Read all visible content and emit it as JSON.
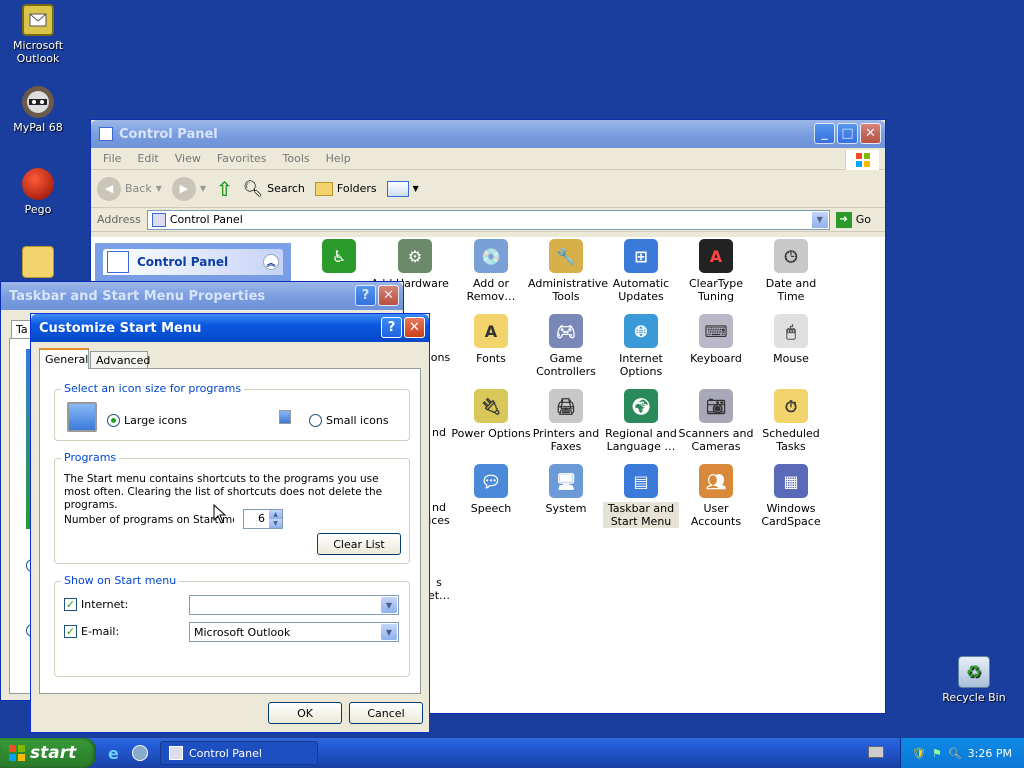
{
  "desktop": {
    "icons": [
      {
        "label": "Microsoft Outlook",
        "icon": "outlook-icon"
      },
      {
        "label": "MyPal 68",
        "icon": "raccoon-icon"
      },
      {
        "label": "Pego",
        "icon": "pego-icon"
      },
      {
        "label": "Recycle Bin",
        "icon": "recycle-bin-icon"
      }
    ]
  },
  "control_panel": {
    "title": "Control Panel",
    "menu": [
      "File",
      "Edit",
      "View",
      "Favorites",
      "Tools",
      "Help"
    ],
    "toolbar": {
      "back": "Back",
      "search": "Search",
      "folders": "Folders"
    },
    "address_label": "Address",
    "address_value": "Control Panel",
    "go_label": "Go",
    "sidebar_title": "Control Panel",
    "items": [
      "Add Hardware",
      "Add or Remov…",
      "Administrative Tools",
      "Automatic Updates",
      "ClearType Tuning",
      "Date and Time",
      "Fonts",
      "Game Controllers",
      "Internet Options",
      "Keyboard",
      "Mouse",
      "Power Options",
      "Printers and Faxes",
      "Regional and Language …",
      "Scanners and Cameras",
      "Scheduled Tasks",
      "Speech",
      "System",
      "Taskbar and Start Menu",
      "User Accounts",
      "Windows CardSpace"
    ],
    "partial_labels": {
      "row2": "ions",
      "row3a": "nd",
      "row4a": "nd",
      "row4b": "ices",
      "row5a": "s",
      "row5b": "et…"
    }
  },
  "taskbar_props": {
    "title": "Taskbar and Start Menu Properties",
    "tab_stub": "Ta"
  },
  "customize": {
    "title": "Customize Start Menu",
    "tabs": [
      "General",
      "Advanced"
    ],
    "icon_size_group": "Select an icon size for programs",
    "large_icons": "Large icons",
    "small_icons": "Small icons",
    "programs_group": "Programs",
    "programs_desc": "The Start menu contains shortcuts to the programs you use most often. Clearing the list of shortcuts does not delete the programs.",
    "num_programs_label": "Number of programs on Start menu:",
    "num_programs_value": "6",
    "clear_list": "Clear List",
    "show_group": "Show on Start menu",
    "internet_label": "Internet:",
    "internet_value": "",
    "email_label": "E-mail:",
    "email_value": "Microsoft Outlook",
    "ok": "OK",
    "cancel": "Cancel"
  },
  "taskbar": {
    "start_label": "start",
    "task_label": "Control Panel",
    "clock": "3:26 PM"
  }
}
